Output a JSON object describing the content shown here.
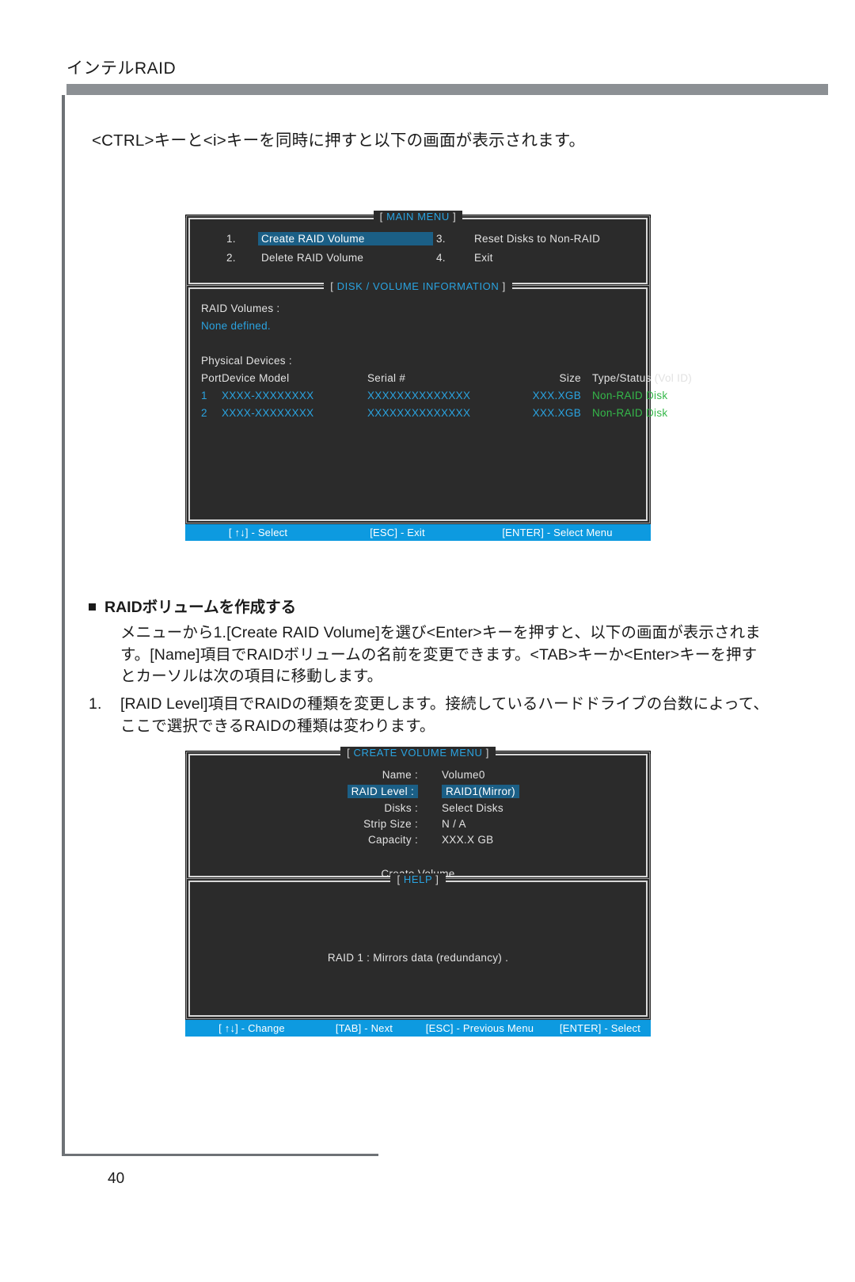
{
  "page": {
    "header_title": "インテルRAID",
    "number": "40",
    "intro_text": "<CTRL>キーと<i>キーを同時に押すと以下の画面が表示されます。"
  },
  "section": {
    "heading": "RAIDボリュームを作成する",
    "paragraph": "メニューから1.[Create RAID Volume]を選び<Enter>キーを押すと、以下の画面が表示されます。[Name]項目でRAIDボリュームの名前を変更できます。<TAB>キーか<Enter>キーを押すとカーソルは次の項目に移動します。",
    "item_number": "1.",
    "item_text": "[RAID Level]項目でRAIDの種類を変更します。接続しているハードドライブの台数によって、ここで選択できるRAIDの種類は変わります。"
  },
  "main_menu_screen": {
    "panel_title": "MAIN  MENU",
    "bracket_open": "[",
    "bracket_close": "]",
    "items": [
      {
        "num": "1.",
        "label": "Create  RAID  Volume",
        "selected": true
      },
      {
        "num": "3.",
        "label": "Reset Disks to Non-RAID",
        "selected": false
      },
      {
        "num": "2.",
        "label": "Delete  RAID  Volume",
        "selected": false
      },
      {
        "num": "4.",
        "label": "Exit",
        "selected": false
      }
    ],
    "info_panel_title": "DISK / VOLUME INFORMATION",
    "raid_volumes_label": "RAID  Volumes :",
    "raid_volumes_value": "None  defined.",
    "physical_devices_label": "Physical  Devices :",
    "columns": {
      "port": "Port",
      "model": "Device  Model",
      "serial": "Serial  #",
      "size": "Size",
      "type": "Type/Status (Vol  ID)"
    },
    "devices": [
      {
        "port": "1",
        "model": "XXXX-XXXXXXXX",
        "serial": "XXXXXXXXXXXXXX",
        "size": "XXX.XGB",
        "type": "Non-RAID  Disk"
      },
      {
        "port": "2",
        "model": "XXXX-XXXXXXXX",
        "serial": "XXXXXXXXXXXXXX",
        "size": "XXX.XGB",
        "type": "Non-RAID  Disk"
      }
    ],
    "status_bar": [
      "[ ↑↓] - Select",
      "[ESC] - Exit",
      "[ENTER] - Select Menu"
    ]
  },
  "create_volume_screen": {
    "panel_title": "CREATE VOLUME MENU",
    "bracket_open": "[",
    "bracket_close": "]",
    "fields": [
      {
        "label": "Name :",
        "value": "Volume0",
        "selected": false
      },
      {
        "label": "RAID Level :",
        "value": "RAID1(Mirror)",
        "selected": true
      },
      {
        "label": "Disks :",
        "value": "Select  Disks",
        "selected": false
      },
      {
        "label": "Strip Size :",
        "value": "N / A",
        "selected": false
      },
      {
        "label": "Capacity :",
        "value": "XXX.X  GB",
        "selected": false
      }
    ],
    "create_button": "Create Volume",
    "help_panel_title": "HELP",
    "help_text": "RAID  1 : Mirrors  data  (redundancy) .",
    "status_bar": [
      "[ ↑↓] - Change",
      "[TAB] - Next",
      "[ESC] - Previous Menu",
      "[ENTER] - Select"
    ]
  },
  "colors": {
    "accent_blue": "#2aa3e0",
    "status_bar_blue": "#0d9ae0",
    "highlight_blue": "#1b5f86",
    "green": "#35b84a",
    "rule_gray": "#8c9094"
  }
}
